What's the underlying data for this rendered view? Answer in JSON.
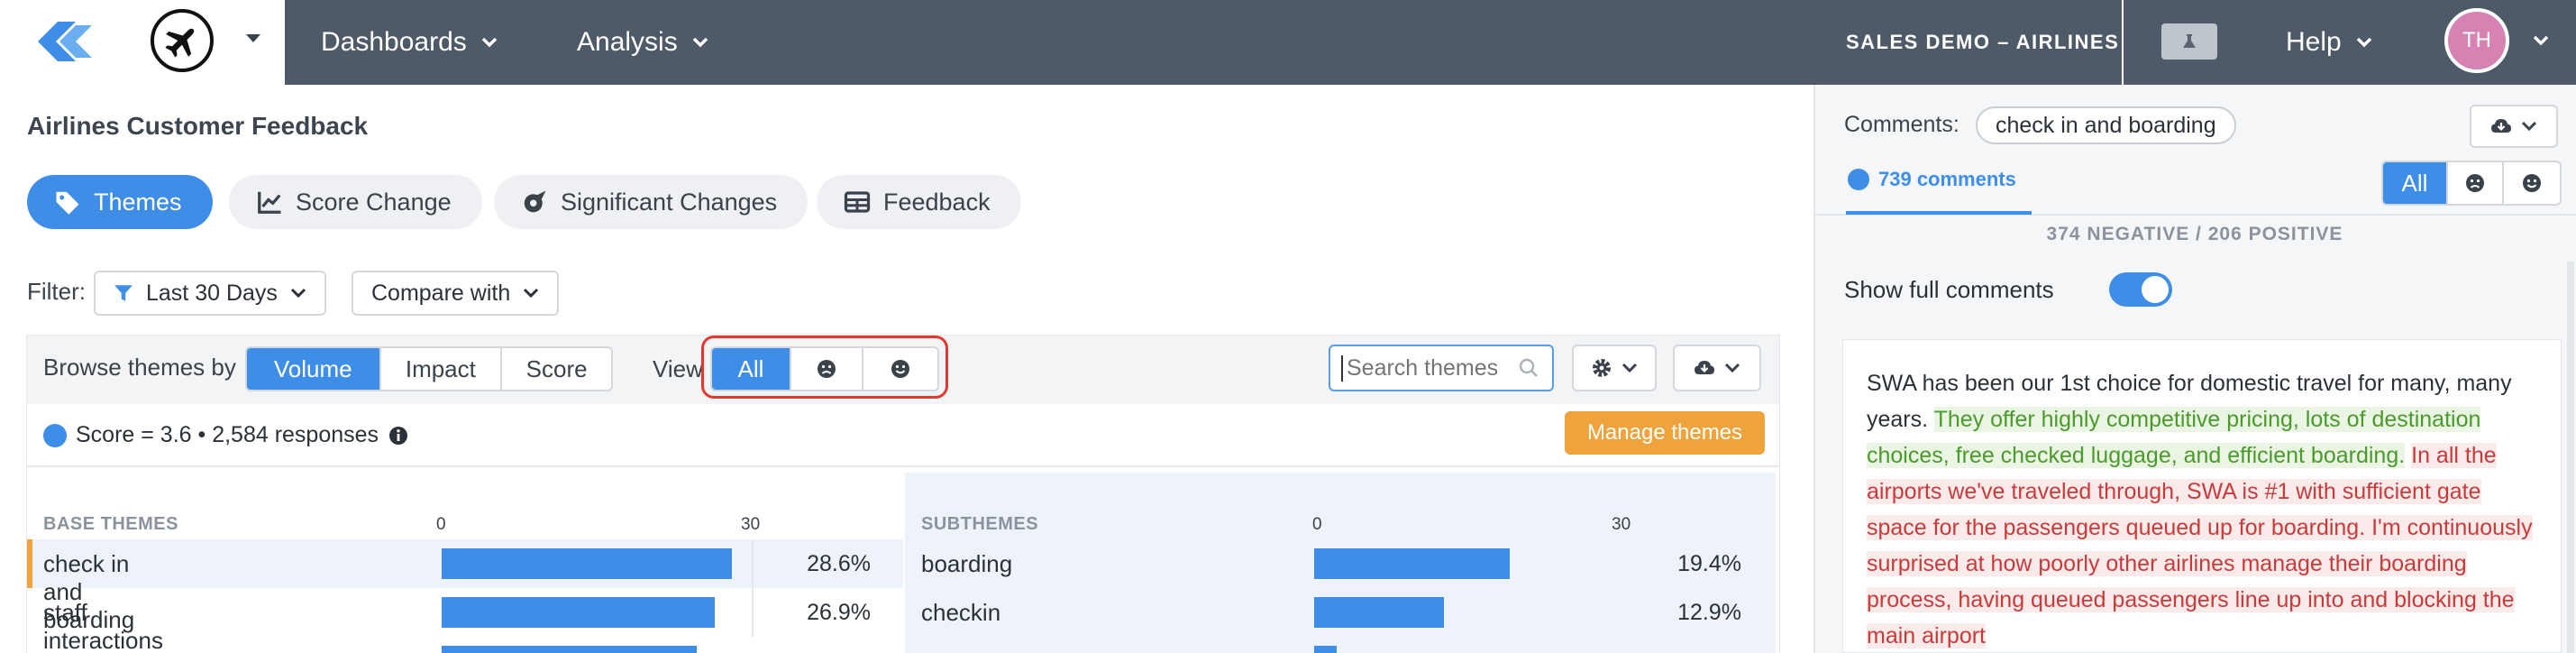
{
  "topbar": {
    "nav": [
      {
        "label": "Dashboards"
      },
      {
        "label": "Analysis"
      }
    ],
    "org_name": "SALES DEMO – AIRLINES",
    "help_label": "Help",
    "avatar_initials": "TH"
  },
  "page": {
    "title": "Airlines Customer Feedback",
    "tabs": [
      {
        "label": "Themes",
        "icon": "tag-icon",
        "active": true
      },
      {
        "label": "Score Change",
        "icon": "line-chart-icon",
        "active": false
      },
      {
        "label": "Significant Changes",
        "icon": "rocket-icon",
        "active": false
      },
      {
        "label": "Feedback",
        "icon": "table-icon",
        "active": false
      }
    ],
    "filter": {
      "label": "Filter:",
      "date_range": "Last 30 Days",
      "compare": "Compare with"
    }
  },
  "browse": {
    "label": "Browse themes by",
    "options": [
      "Volume",
      "Impact",
      "Score"
    ],
    "selected": "Volume",
    "view_label": "View",
    "view_options": [
      {
        "label": "All",
        "icon": null
      },
      {
        "label": "",
        "icon": "frown-icon"
      },
      {
        "label": "",
        "icon": "smile-icon"
      }
    ],
    "search_placeholder": "Search themes",
    "score_summary": "Score = 3.6 • 2,584 responses",
    "manage_label": "Manage themes",
    "base_header": "BASE THEMES",
    "sub_header": "SUBTHEMES",
    "axis_ticks": [
      "0",
      "30"
    ],
    "axis_max": 30,
    "base_themes": [
      {
        "label": "check in and boarding",
        "value": 28.6,
        "display": "28.6%"
      },
      {
        "label": "staff interactions",
        "value": 26.9,
        "display": "26.9%"
      },
      {
        "label": "",
        "value": 25.1,
        "display": ""
      }
    ],
    "subthemes": [
      {
        "label": "boarding",
        "value": 19.4,
        "display": "19.4%"
      },
      {
        "label": "checkin",
        "value": 12.9,
        "display": "12.9%"
      },
      {
        "label": "",
        "value": 2.2,
        "display": ""
      }
    ]
  },
  "comments": {
    "label": "Comments:",
    "selected_theme": "check in and boarding",
    "count_tab": "739 comments",
    "filter_options": [
      "All"
    ],
    "summary": "374 NEGATIVE / 206 POSITIVE",
    "show_full_label": "Show full comments",
    "show_full_on": true,
    "comment": {
      "neutral": "SWA has been our 1st choice for domestic travel for many, many years.",
      "positive": "They offer highly competitive pricing, lots of destination choices, free checked luggage, and efficient boarding.",
      "negative": "In all the airports we've traveled through, SWA is #1 with sufficient gate space for the passengers queued up for boarding. I'm continuously surprised at how poorly other airlines manage their boarding process, having queued passengers line up into and blocking the main airport"
    }
  },
  "colors": {
    "topbar": "#4e5a68",
    "accent": "#3e8ee8",
    "manage": "#f0a33c",
    "highlight": "#e03a2f",
    "positive": "#4b9a2c",
    "negative": "#c93b3b",
    "avatar": "#d682b3"
  }
}
